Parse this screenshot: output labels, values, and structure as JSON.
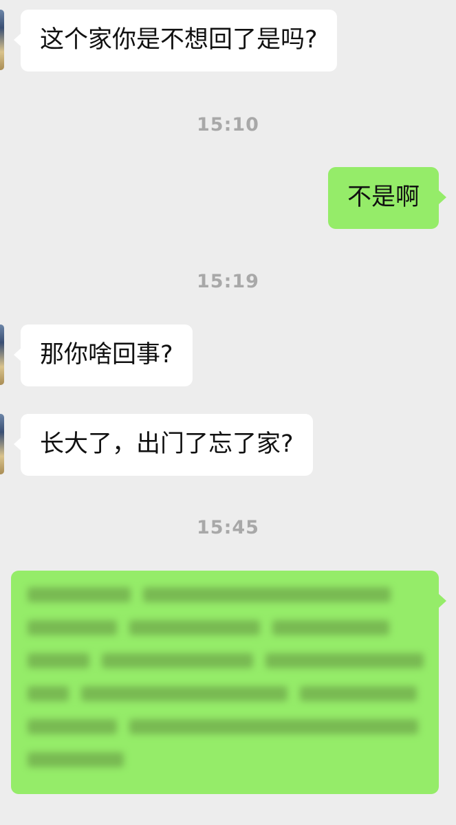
{
  "messages": [
    {
      "type": "incoming",
      "text": "这个家你是不想回了是吗?"
    },
    {
      "type": "time",
      "text": "15:10"
    },
    {
      "type": "outgoing",
      "text": "不是啊"
    },
    {
      "type": "time",
      "text": "15:19"
    },
    {
      "type": "incoming",
      "text": "那你啥回事?"
    },
    {
      "type": "incoming",
      "text": "长大了，出门了忘了家?"
    },
    {
      "type": "time",
      "text": "15:45"
    },
    {
      "type": "outgoing",
      "blurred": true
    }
  ]
}
